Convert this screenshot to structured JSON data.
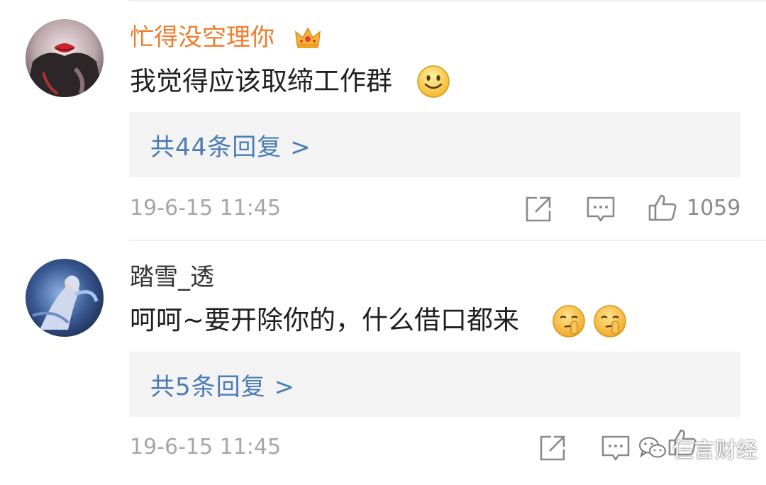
{
  "comments": [
    {
      "username": "忙得没空理你",
      "content": "我觉得应该取缔工作群",
      "reply_link": "共44条回复 >",
      "timestamp": "19-6-15 11:45",
      "like_count": "1059"
    },
    {
      "username": "踏雪_透",
      "content": "呵呵~要开除你的，什么借口都来",
      "reply_link": "共5条回复 >",
      "timestamp": "19-6-15 11:45",
      "like_count": ""
    }
  ],
  "watermark": {
    "text": "仨言财经"
  },
  "colors": {
    "vip_username": "#f07c2a",
    "reply_link": "#4a7cb6",
    "reply_box_bg": "#f3f3f3",
    "meta_text": "#a6a6a6"
  },
  "icons": [
    "crown-icon",
    "smile-emoji-icon",
    "shush-emoji-icon",
    "share-icon",
    "comment-icon",
    "thumbs-up-icon",
    "wechat-icon"
  ]
}
